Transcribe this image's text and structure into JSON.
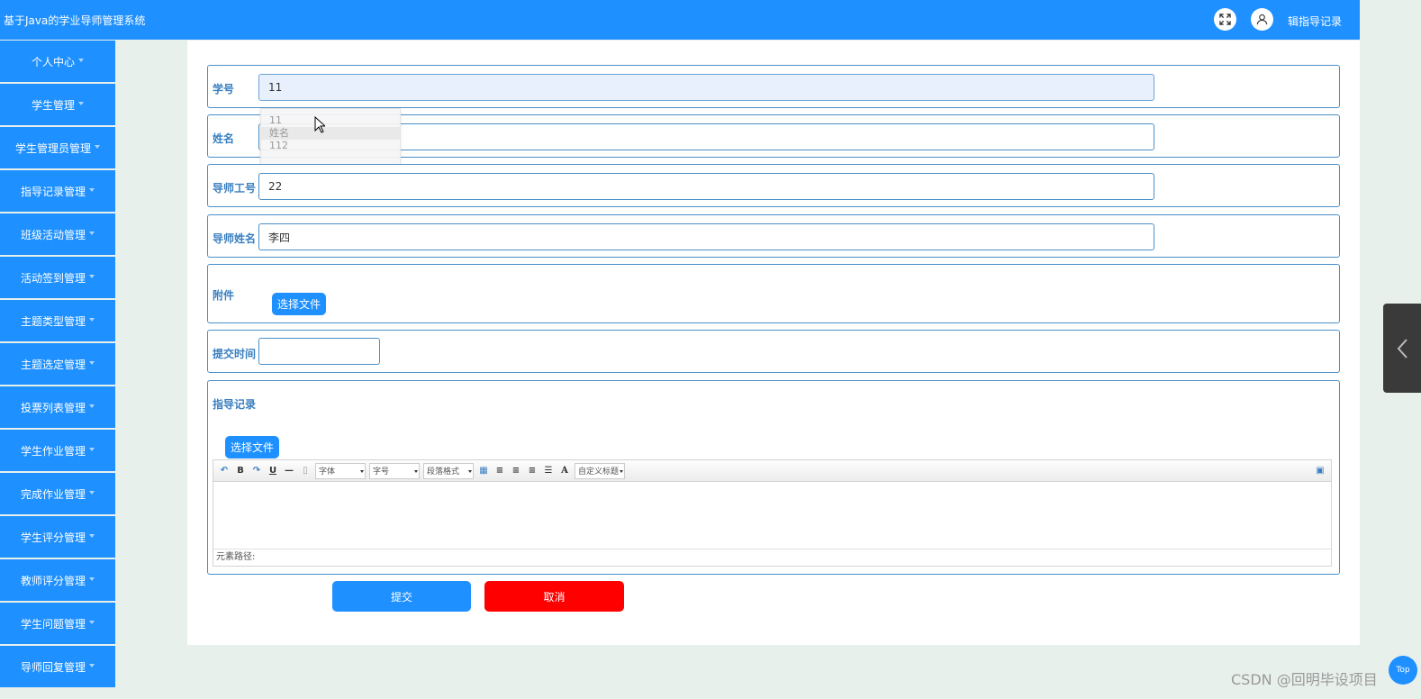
{
  "header": {
    "title": "基于Java的学业导师管理系统",
    "user_label": "辑指导记录"
  },
  "sidebar": {
    "items": [
      {
        "label": "个人中心"
      },
      {
        "label": "学生管理"
      },
      {
        "label": "学生管理员管理"
      },
      {
        "label": "指导记录管理"
      },
      {
        "label": "班级活动管理"
      },
      {
        "label": "活动签到管理"
      },
      {
        "label": "主题类型管理"
      },
      {
        "label": "主题选定管理"
      },
      {
        "label": "投票列表管理"
      },
      {
        "label": "学生作业管理"
      },
      {
        "label": "完成作业管理"
      },
      {
        "label": "学生评分管理"
      },
      {
        "label": "教师评分管理"
      },
      {
        "label": "学生问题管理"
      },
      {
        "label": "导师回复管理"
      }
    ]
  },
  "form": {
    "student_id": {
      "label": "学号",
      "value": "11"
    },
    "autocomplete": [
      "11",
      "姓名",
      "112"
    ],
    "name": {
      "label": "姓名",
      "value": "",
      "placeholder": "姓名"
    },
    "tutor_id": {
      "label": "导师工号",
      "value": "22"
    },
    "tutor_name": {
      "label": "导师姓名",
      "value": "李四"
    },
    "attachment": {
      "label": "附件",
      "button": "选择文件"
    },
    "submit_time": {
      "label": "提交时间",
      "value": ""
    },
    "guidance_record": {
      "label": "指导记录",
      "button": "选择文件",
      "toolbar": {
        "font_family": "字体",
        "font_size": "字号",
        "paragraph": "段落格式",
        "custom_title": "自定义标题"
      },
      "status": "元素路径:"
    },
    "submit_label": "提交",
    "cancel_label": "取消"
  },
  "colors": {
    "primary": "#1e90ff",
    "danger": "#ff0000",
    "label": "#3a7fc0",
    "background": "#e8f0ec"
  },
  "widgets": {
    "top_badge": "Top",
    "watermark": "CSDN @回明毕设项目"
  }
}
